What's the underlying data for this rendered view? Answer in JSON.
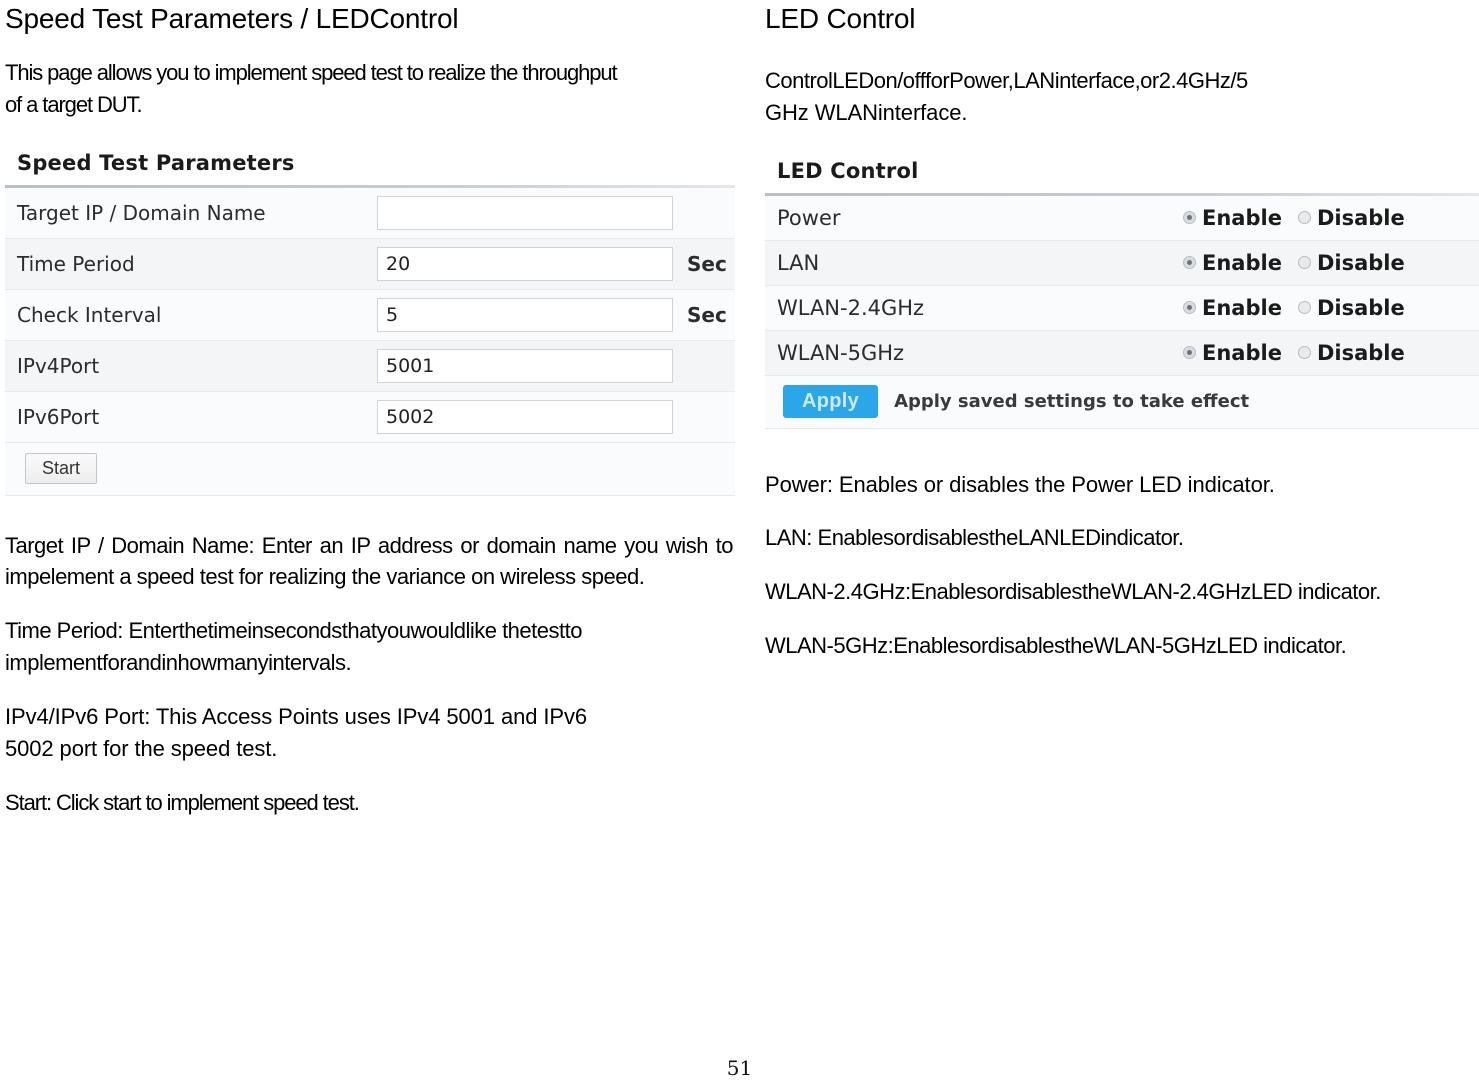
{
  "left": {
    "heading": "Speed Test Parameters / LEDControl",
    "intro": "This page allows you to implement speed test to realize the throughput of a target DUT.",
    "figure": {
      "title": "Speed Test Parameters",
      "rows": [
        {
          "label": "Target IP / Domain Name",
          "value": "",
          "unit": ""
        },
        {
          "label": "Time Period",
          "value": "20",
          "unit": "Sec"
        },
        {
          "label": "Check Interval",
          "value": "5",
          "unit": "Sec"
        },
        {
          "label": "IPv4Port",
          "value": "5001",
          "unit": ""
        },
        {
          "label": "IPv6Port",
          "value": "5002",
          "unit": ""
        }
      ],
      "start_button": "Start"
    },
    "paragraphs": [
      "Target IP / Domain Name: Enter an IP address or domain name you wish to impelement a speed test for realizing the variance on wireless speed.",
      "Time Period: Enterthetimeinsecondsthatyouwouldlike thetestto implementforandinhowmanyintervals.",
      "IPv4/IPv6 Port: This Access Points uses IPv4 5001 and IPv6 5002 port for the speed test.",
      "Start: Click start to implement speed test."
    ]
  },
  "right": {
    "heading": "LED Control",
    "intro_line1": "ControlLEDon/offforPower,LANinterface,or2.4GHz/5",
    "intro_line2": "GHz WLANinterface.",
    "figure": {
      "title": "LED Control",
      "enable_label": "Enable",
      "disable_label": "Disable",
      "rows": [
        {
          "label": "Power",
          "selected": "Enable"
        },
        {
          "label": "LAN",
          "selected": "Enable"
        },
        {
          "label": "WLAN-2.4GHz",
          "selected": "Enable"
        },
        {
          "label": "WLAN-5GHz",
          "selected": "Enable"
        }
      ],
      "apply_button": "Apply",
      "apply_note": "Apply saved settings to take effect",
      "apply_color": "#2ba6e8"
    },
    "paragraphs": [
      "Power: Enables or disables the Power LED indicator.",
      "LAN: EnablesordisablestheLANLEDindicator.",
      "WLAN-2.4GHz:EnablesordisablestheWLAN-2.4GHzLED indicator.",
      "WLAN-5GHz:EnablesordisablestheWLAN-5GHzLED indicator."
    ]
  },
  "footer": {
    "page_number": "51"
  }
}
